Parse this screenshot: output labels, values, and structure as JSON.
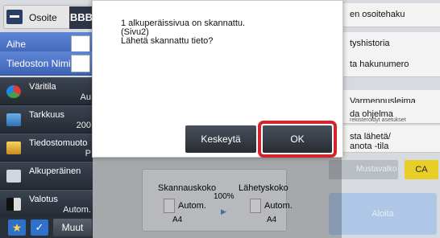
{
  "address": {
    "label": "Osoite",
    "bbb": "BBB"
  },
  "fields": {
    "subject": "Aihe",
    "filename": "Tiedoston Nimi"
  },
  "menu": [
    {
      "label": "Väritila",
      "value": "Au"
    },
    {
      "label": "Tarkkuus",
      "value": "200"
    },
    {
      "label": "Tiedostomuoto",
      "value": "P"
    },
    {
      "label": "Alkuperäinen",
      "value": ""
    },
    {
      "label": "Valotus",
      "value": "Autom."
    }
  ],
  "bottom": {
    "more": "Muut"
  },
  "right_items": [
    {
      "label": "en osoitehaku",
      "sub": ""
    },
    {
      "label": "tyshistoria",
      "sub": ""
    },
    {
      "label": "ta hakunumero",
      "sub": ""
    },
    {
      "label": "Varmennusleima",
      "sub": ""
    },
    {
      "label": "da ohjelma",
      "sub": "rekisteröidyt asetukset"
    },
    {
      "label": "sta lähetä/",
      "sub": ""
    }
  ],
  "right_extra_line": "anota -tila",
  "color_buttons": {
    "bw": "Mustavalko",
    "ca": "CA"
  },
  "start": {
    "label": "Aloita"
  },
  "info": {
    "scan_size_label": "Skannauskoko",
    "send_size_label": "Lähetyskoko",
    "scale": "100%",
    "scan_auto": "Autom.",
    "send_auto": "Autom.",
    "scan_paper": "A4",
    "send_paper": "A4"
  },
  "dialog": {
    "line1": "1 alkuperäissivua on skannattu.",
    "line2": "(Sivu2)",
    "line3": "Lähetä skannattu tieto?",
    "cancel": "Keskeytä",
    "ok": "OK"
  },
  "colors": {
    "highlight": "#d3252e",
    "field_blue": "#4f74c7",
    "ca_yellow": "#e8cf28"
  }
}
